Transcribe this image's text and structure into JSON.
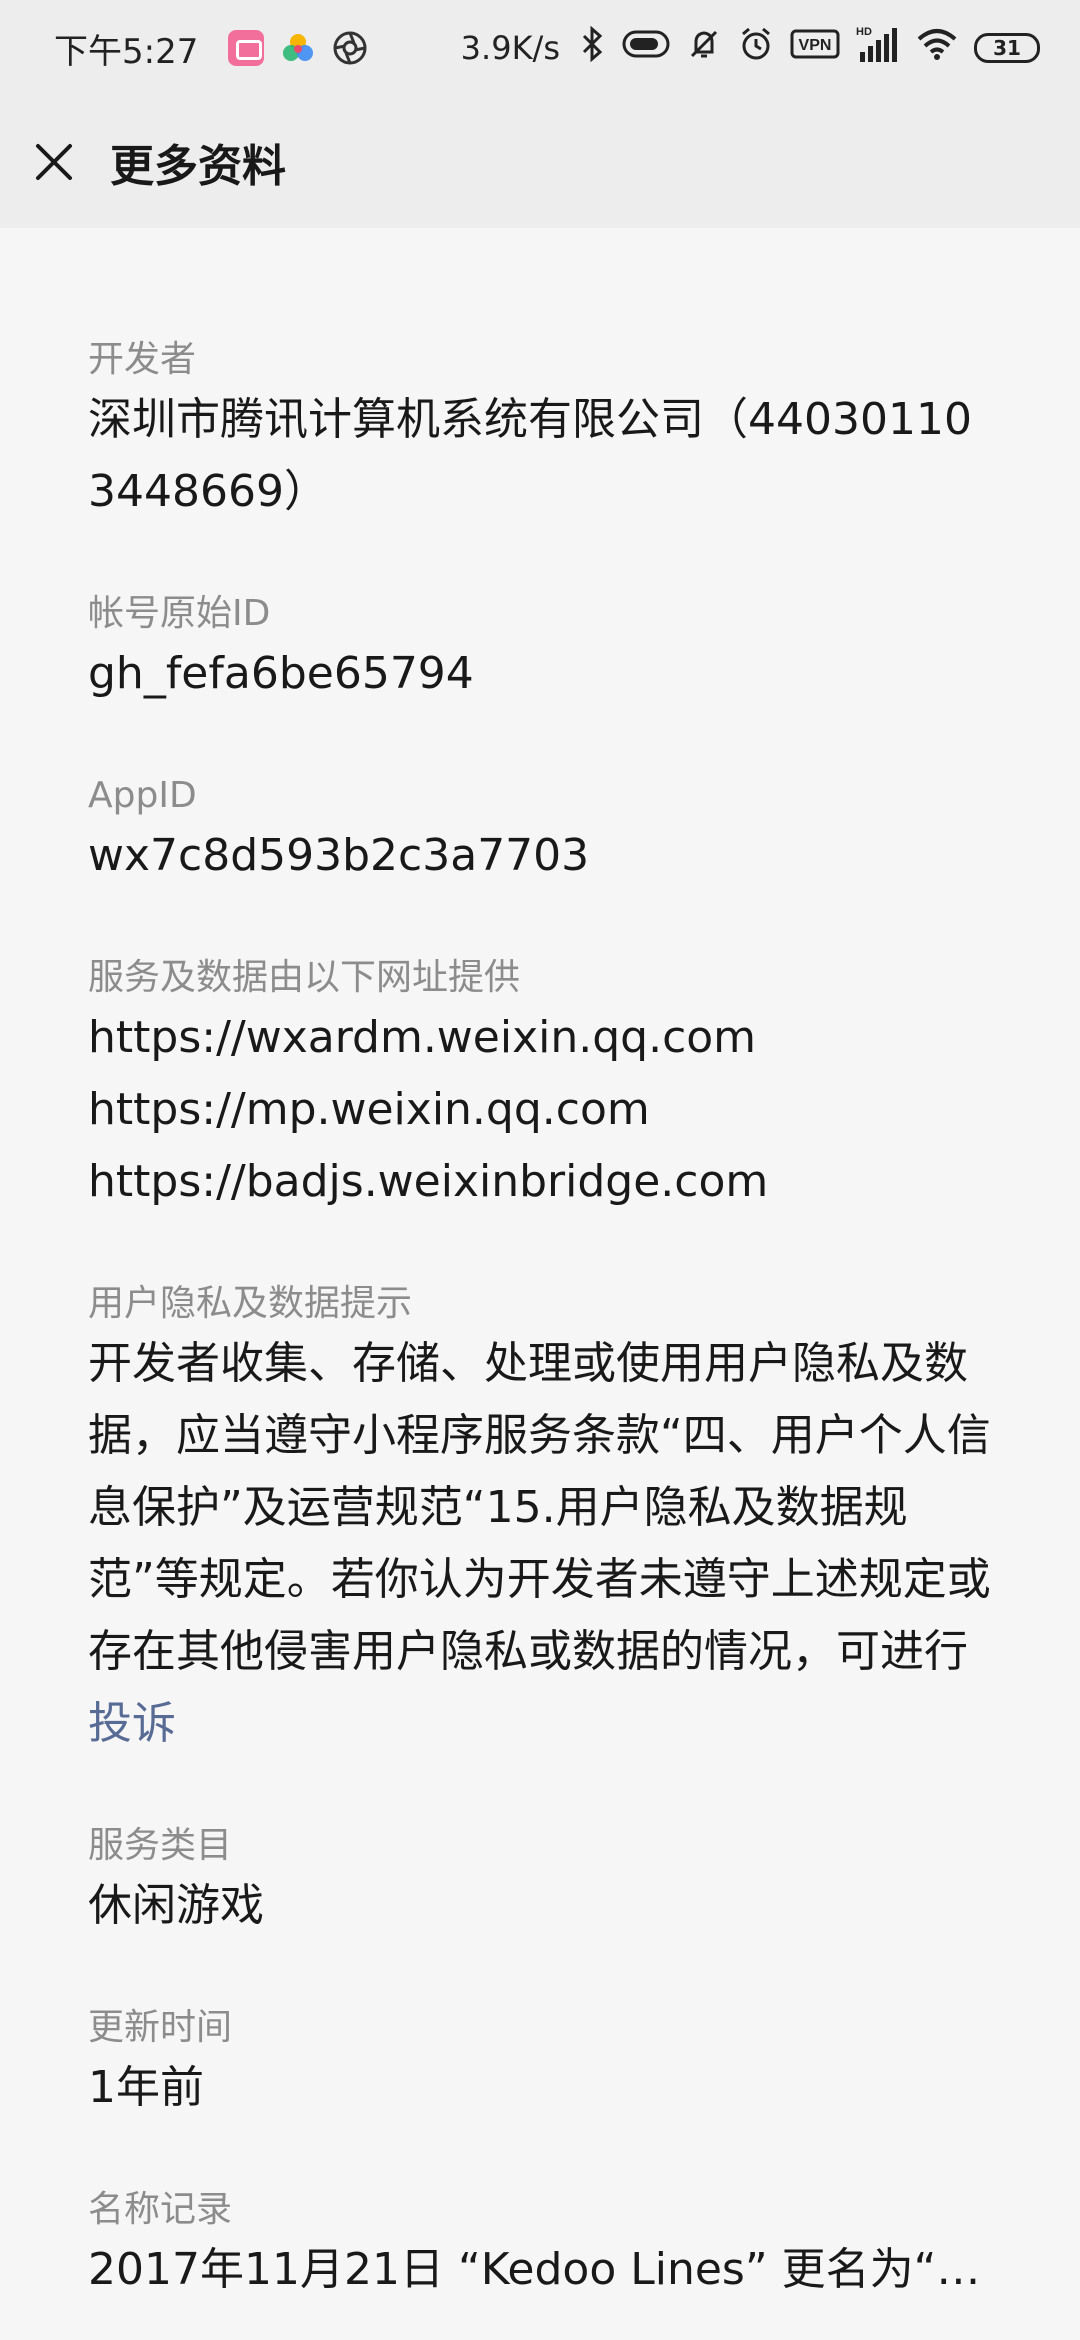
{
  "status_bar": {
    "time": "下午5:27",
    "network_speed": "3.9K/s",
    "battery_level": "31",
    "vpn_label": "VPN",
    "hd_label": "HD"
  },
  "header": {
    "title": "更多资料"
  },
  "sections": {
    "developer": {
      "label": "开发者",
      "value": "深圳市腾讯计算机系统有限公司（440301103448669）"
    },
    "account_id": {
      "label": "帐号原始ID",
      "value": "gh_fefa6be65794"
    },
    "app_id": {
      "label": "AppID",
      "value": "wx7c8d593b2c3a7703"
    },
    "service_urls": {
      "label": "服务及数据由以下网址提供",
      "urls": [
        "https://wxardm.weixin.qq.com",
        "https://mp.weixin.qq.com",
        "https://badjs.weixinbridge.com"
      ]
    },
    "privacy": {
      "label": "用户隐私及数据提示",
      "text": "开发者收集、存储、处理或使用用户隐私及数据，应当遵守小程序服务条款“四、用户个人信息保护”及运营规范“15.用户隐私及数据规范”等规定。若你认为开发者未遵守上述规定或存在其他侵害用户隐私或数据的情况，可进行",
      "link_text": "投诉"
    },
    "category": {
      "label": "服务类目",
      "value": "休闲游戏"
    },
    "update_time": {
      "label": "更新时间",
      "value": "1年前"
    },
    "name_history": {
      "label": "名称记录",
      "value": "2017年11月21日 “Kedoo Lines” 更名为“…"
    }
  },
  "colors": {
    "page_bg": "#f6f6f6",
    "bar_bg": "#ededed",
    "label": "#8c8c8c",
    "text": "#191919",
    "link": "#576b95"
  }
}
